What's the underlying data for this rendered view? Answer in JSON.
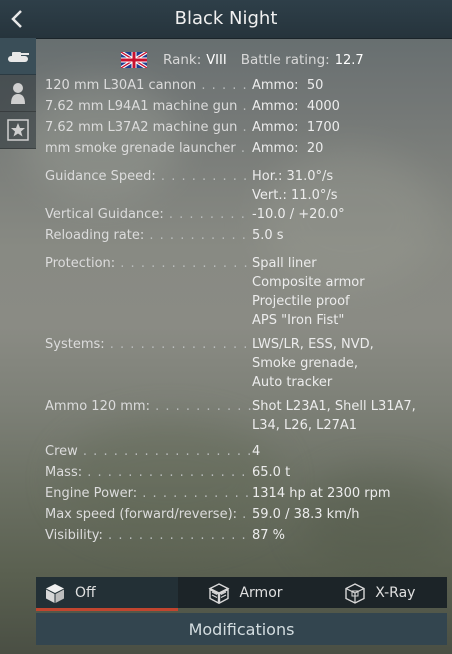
{
  "header": {
    "title": "Black Night",
    "back_icon": "chevron-left-icon"
  },
  "sidebar": {
    "items": [
      {
        "icon": "tank-icon",
        "active": true
      },
      {
        "icon": "crew-icon",
        "active": false
      },
      {
        "icon": "star-icon",
        "active": false
      }
    ]
  },
  "rank": {
    "flag": "uk-flag-icon",
    "rank_label": "Rank:",
    "rank_value": "VIII",
    "br_label": "Battle rating:",
    "br_value": "12.7"
  },
  "weapons": [
    {
      "name": "120 mm L30A1 cannon",
      "ammo_label": "Ammo:",
      "ammo": "50"
    },
    {
      "name": "7.62 mm L94A1 machine gun",
      "ammo_label": "Ammo:",
      "ammo": "4000"
    },
    {
      "name": "7.62 mm L37A2 machine gun",
      "ammo_label": "Ammo:",
      "ammo": "1700"
    },
    {
      "name": "mm smoke grenade launcher",
      "ammo_label": "Ammo:",
      "ammo": "20"
    }
  ],
  "specs": {
    "guidance_speed": {
      "label": "Guidance Speed:",
      "hor": "Hor.: 31.0°/s",
      "vert": "Vert.: 11.0°/s"
    },
    "vertical_guidance": {
      "label": "Vertical Guidance:",
      "value": "-10.0 / +20.0°"
    },
    "reloading": {
      "label": "Reloading rate:",
      "value": "5.0 s"
    },
    "protection": {
      "label": "Protection:",
      "values": [
        "Spall liner",
        "Composite armor",
        "Projectile proof",
        "APS \"Iron Fist\""
      ]
    },
    "systems": {
      "label": "Systems:",
      "values": [
        "LWS/LR, ESS, NVD,",
        "Smoke grenade,",
        "Auto tracker"
      ]
    },
    "ammo120": {
      "label": "Ammo 120 mm:",
      "values": [
        "Shot L23A1, Shell L31A7,",
        "L34, L26, L27A1"
      ]
    },
    "crew": {
      "label": "Crew",
      "value": "4"
    },
    "mass": {
      "label": "Mass:",
      "value": "65.0 t"
    },
    "engine": {
      "label": "Engine Power:",
      "value": "1314 hp at 2300 rpm"
    },
    "speed": {
      "label": "Max speed (forward/reverse):",
      "value": "59.0 / 38.3 km/h"
    },
    "visibility": {
      "label": "Visibility:",
      "value": "87 %"
    }
  },
  "tabs": [
    {
      "label": "Off",
      "icon": "cube-icon",
      "active": true
    },
    {
      "label": "Armor",
      "icon": "armor-cube-icon",
      "active": false
    },
    {
      "label": "X-Ray",
      "icon": "xray-cube-icon",
      "active": false
    }
  ],
  "modifications": {
    "label": "Modifications"
  },
  "colors": {
    "header": "#2e3f49",
    "accent": "#c1452f",
    "mods_button": "#33454f"
  }
}
